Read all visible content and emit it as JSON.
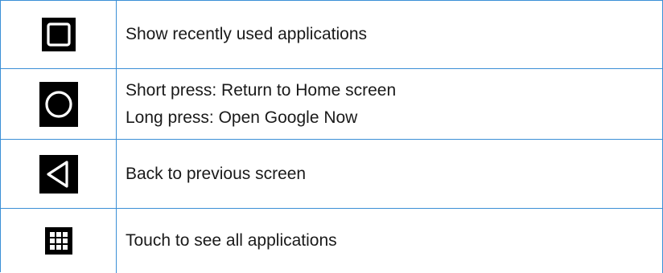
{
  "colors": {
    "border": "#3b8fd6",
    "icon_background": "#000000",
    "icon_stroke": "#ffffff",
    "text": "#1a1a1a"
  },
  "rows": [
    {
      "icon": "recent-apps-square-icon",
      "lines": [
        "Show recently used applications"
      ]
    },
    {
      "icon": "home-circle-icon",
      "lines": [
        "Short press: Return to Home screen",
        "Long press: Open Google Now"
      ]
    },
    {
      "icon": "back-triangle-icon",
      "lines": [
        "Back to previous screen"
      ]
    },
    {
      "icon": "all-apps-grid-icon",
      "lines": [
        "Touch to see all applications"
      ]
    }
  ]
}
